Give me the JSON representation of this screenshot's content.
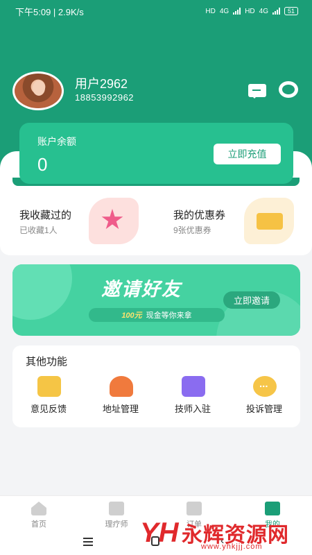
{
  "status_bar": {
    "time": "下午5:09 | 2.9K/s",
    "net1": "HD",
    "net2": "4G",
    "battery": "51"
  },
  "profile": {
    "name": "用户2962",
    "phone": "18853992962"
  },
  "balance": {
    "label": "账户余额",
    "value": "0",
    "recharge_label": "立即充值"
  },
  "quick": {
    "favorites": {
      "title": "我收藏过的",
      "subtitle": "已收藏1人"
    },
    "coupons": {
      "title": "我的优惠券",
      "subtitle": "9张优惠券"
    }
  },
  "banner": {
    "title": "邀请好友",
    "amount": "100元",
    "subtitle": "现金等你来拿",
    "button": "立即邀请"
  },
  "other": {
    "title": "其他功能",
    "items": [
      {
        "label": "意见反馈",
        "icon": "envelope-icon"
      },
      {
        "label": "地址管理",
        "icon": "map-pin-icon"
      },
      {
        "label": "技师入驻",
        "icon": "shop-plus-icon"
      },
      {
        "label": "投诉管理",
        "icon": "chat-bubble-icon"
      }
    ]
  },
  "tabs": [
    {
      "label": "首页",
      "icon": "home-icon"
    },
    {
      "label": "理疗师",
      "icon": "therapist-icon"
    },
    {
      "label": "订单",
      "icon": "order-icon"
    },
    {
      "label": "我的",
      "icon": "profile-icon",
      "active": true
    }
  ],
  "watermark": {
    "logo": "YH",
    "title": "永辉资源网",
    "url": "www.yhkjjj.com"
  },
  "colors": {
    "primary": "#1b9e77",
    "card": "#27c090",
    "banner": "#45d2a1",
    "watermark": "#e0292c"
  }
}
